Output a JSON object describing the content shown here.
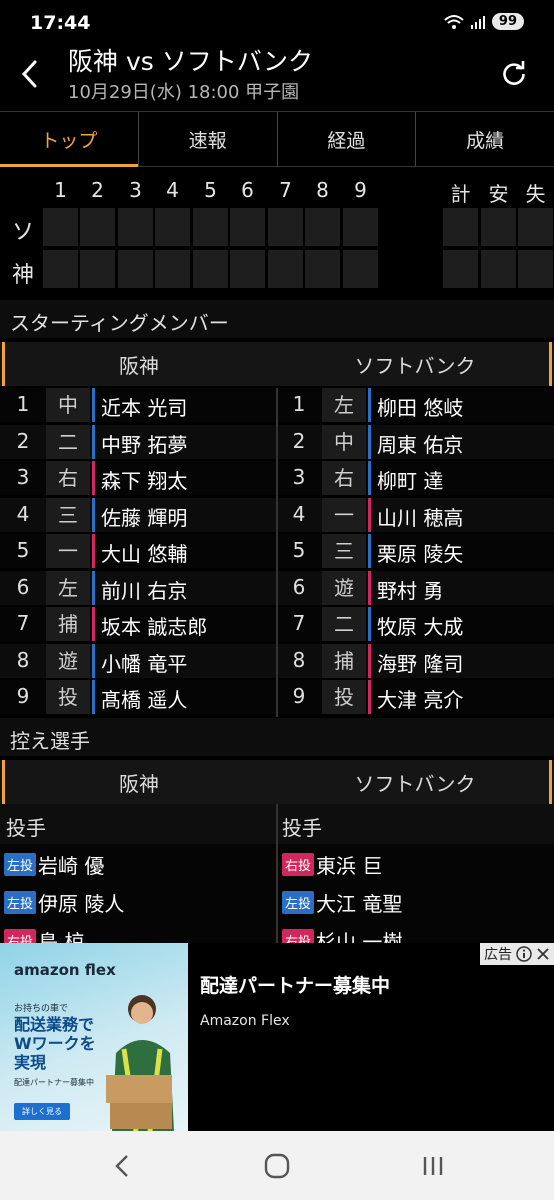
{
  "status": {
    "time": "17:44",
    "battery": "99"
  },
  "header": {
    "title": "阪神 vs ソフトバンク",
    "subtitle": "10月29日(水) 18:00 甲子園"
  },
  "tabs": [
    "トップ",
    "速報",
    "経過",
    "成績"
  ],
  "scoreboard": {
    "innings": [
      "1",
      "2",
      "3",
      "4",
      "5",
      "6",
      "7",
      "8",
      "9"
    ],
    "totals": [
      "計",
      "安",
      "失"
    ],
    "teams": [
      "ソ",
      "神"
    ]
  },
  "starting": {
    "title": "スターティングメンバー",
    "home": "阪神",
    "away": "ソフトバンク",
    "rows": [
      {
        "num": "1",
        "hpos": "中",
        "hname": "近本 光司",
        "hcolor": "#2a6fc4",
        "apos": "左",
        "aname": "柳田 悠岐",
        "acolor": "#2a6fc4"
      },
      {
        "num": "2",
        "hpos": "二",
        "hname": "中野 拓夢",
        "hcolor": "#2a6fc4",
        "apos": "中",
        "aname": "周東 佑京",
        "acolor": "#2a6fc4"
      },
      {
        "num": "3",
        "hpos": "右",
        "hname": "森下 翔太",
        "hcolor": "#d0285e",
        "apos": "右",
        "aname": "柳町 達",
        "acolor": "#2a6fc4"
      },
      {
        "num": "4",
        "hpos": "三",
        "hname": "佐藤 輝明",
        "hcolor": "#2a6fc4",
        "apos": "一",
        "aname": "山川 穂高",
        "acolor": "#d0285e"
      },
      {
        "num": "5",
        "hpos": "一",
        "hname": "大山 悠輔",
        "hcolor": "#d0285e",
        "apos": "三",
        "aname": "栗原 陵矢",
        "acolor": "#2a6fc4"
      },
      {
        "num": "6",
        "hpos": "左",
        "hname": "前川 右京",
        "hcolor": "#2a6fc4",
        "apos": "遊",
        "aname": "野村 勇",
        "acolor": "#d0285e"
      },
      {
        "num": "7",
        "hpos": "捕",
        "hname": "坂本 誠志郎",
        "hcolor": "#d0285e",
        "apos": "二",
        "aname": "牧原 大成",
        "acolor": "#2a6fc4"
      },
      {
        "num": "8",
        "hpos": "遊",
        "hname": "小幡 竜平",
        "hcolor": "#2a6fc4",
        "apos": "捕",
        "aname": "海野 隆司",
        "acolor": "#d0285e"
      },
      {
        "num": "9",
        "hpos": "投",
        "hname": "髙橋 遥人",
        "hcolor": "#2a6fc4",
        "apos": "投",
        "aname": "大津 亮介",
        "acolor": "#d0285e"
      }
    ]
  },
  "bench": {
    "title": "控え選手",
    "home": "阪神",
    "away": "ソフトバンク",
    "pitcher_label_home": "投手",
    "pitcher_label_away": "投手",
    "pitchers": [
      {
        "hbadge": "左投",
        "hname": "岩崎 優",
        "abadge": "右投",
        "aname": "東浜 巨"
      },
      {
        "hbadge": "左投",
        "hname": "伊原 陵人",
        "abadge": "左投",
        "aname": "大江 竜聖"
      },
      {
        "hbadge": "右投",
        "hname": "島 椋",
        "abadge": "右投",
        "aname": "杉山 一樹"
      }
    ]
  },
  "ad": {
    "brand": "amazon flex",
    "small": "お持ちの車で",
    "big": "配送業務で Wワークを 実現",
    "sub": "配達パートナー募集中",
    "button": "詳しく見る",
    "title": "配達パートナー募集中",
    "advertiser": "Amazon Flex",
    "tag": "広告"
  }
}
